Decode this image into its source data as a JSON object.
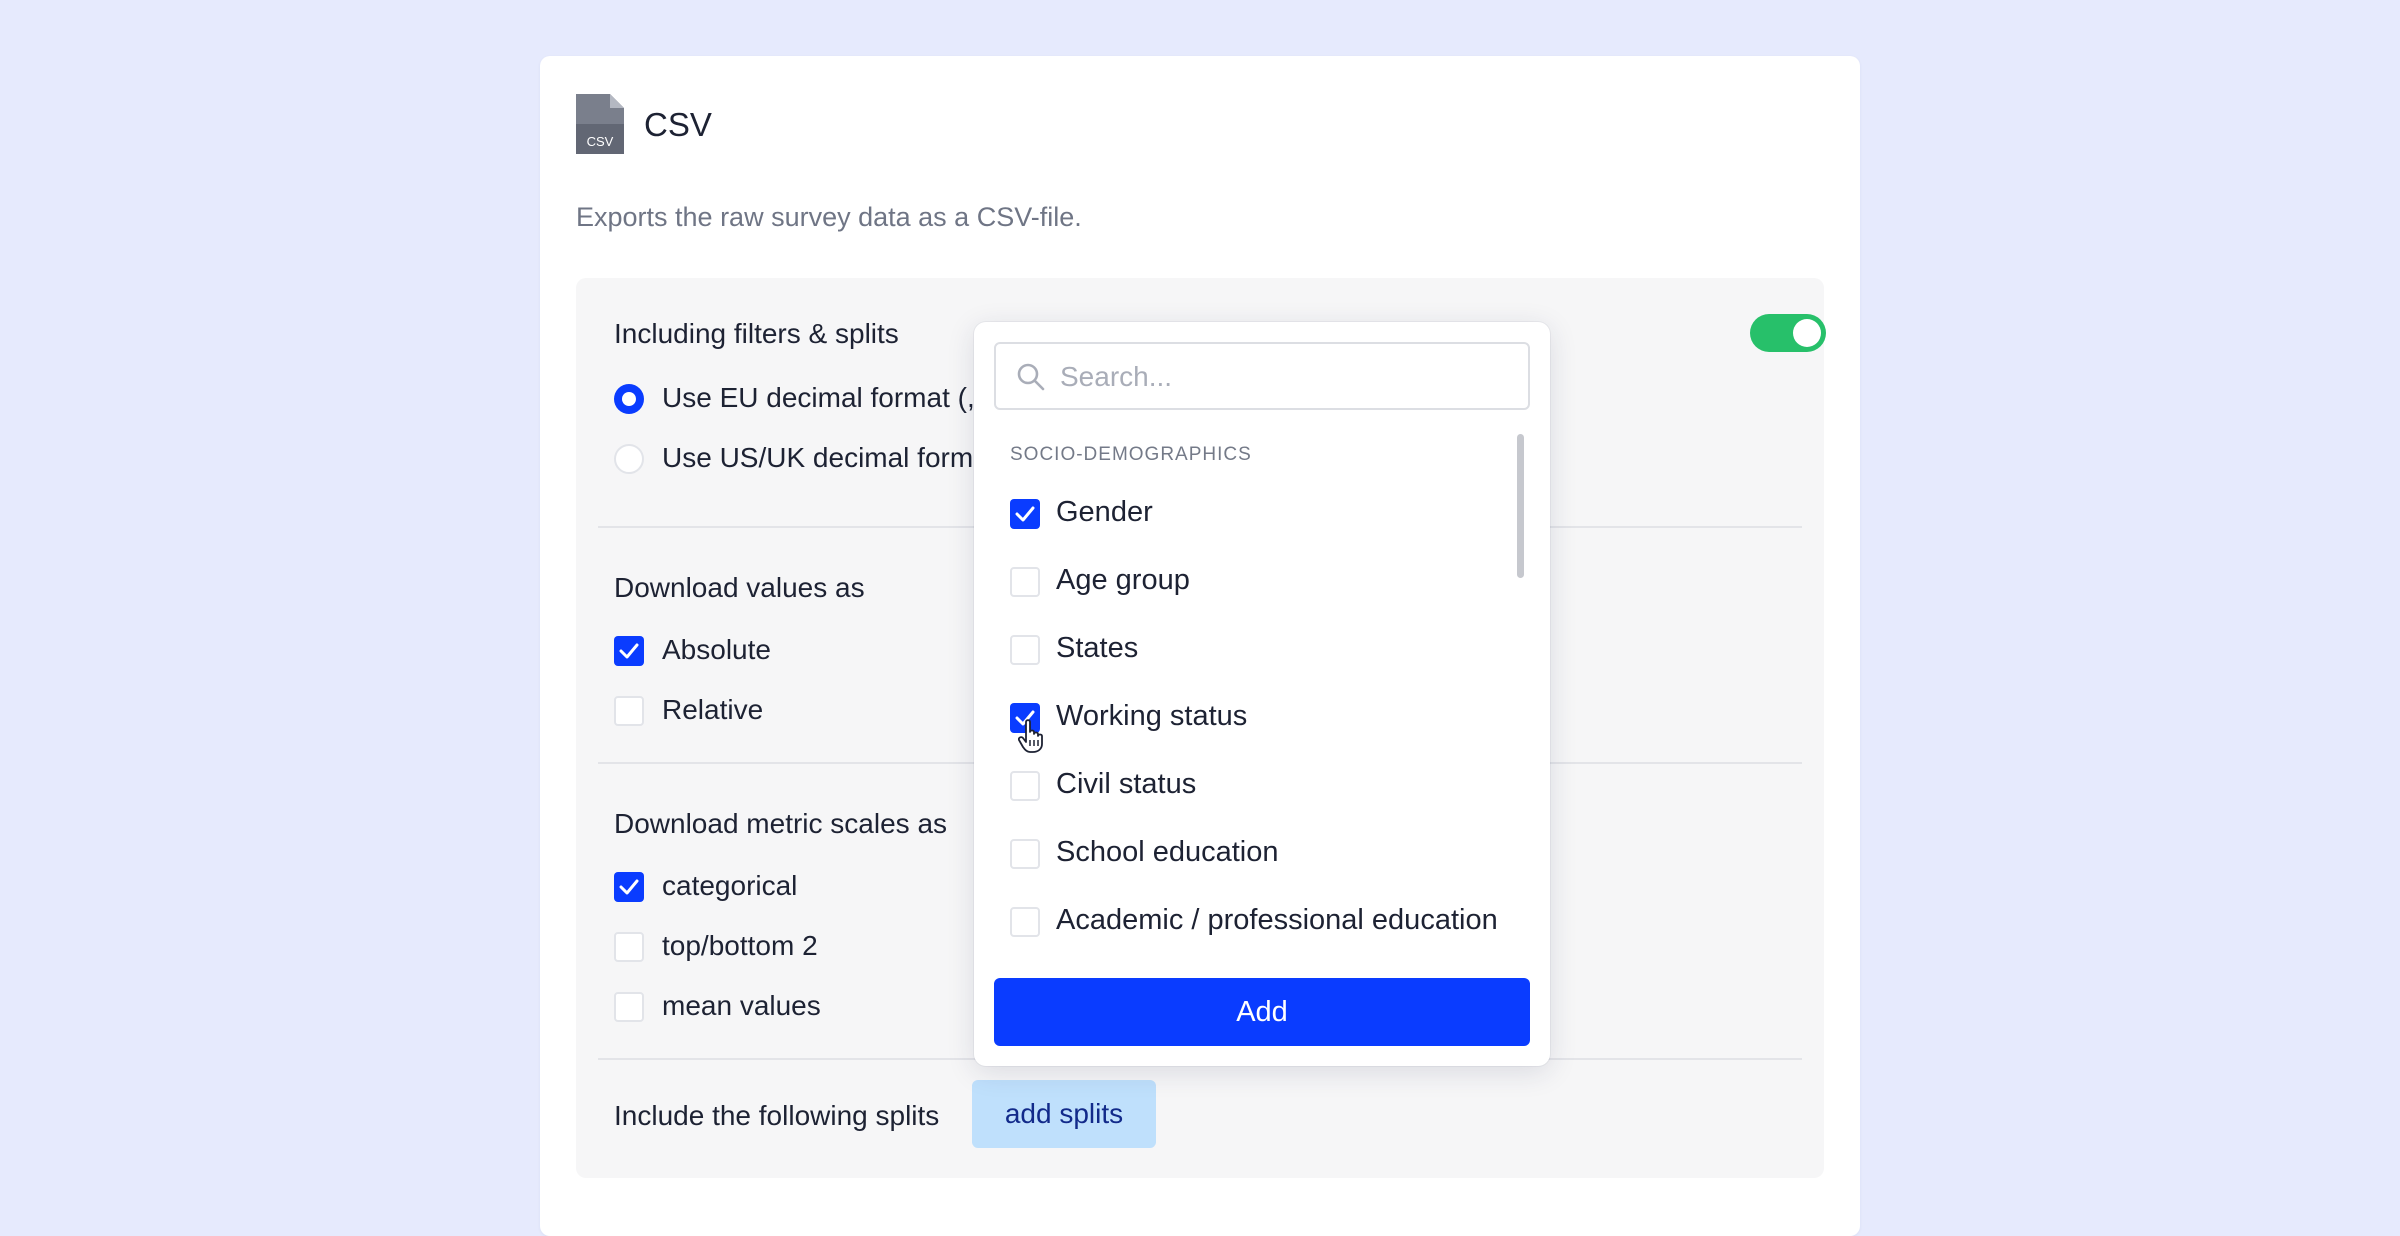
{
  "card": {
    "file_icon_text": "CSV",
    "title": "CSV",
    "description": "Exports the raw survey data as a CSV-file."
  },
  "panel": {
    "filters_label": "Including filters & splits",
    "filters_toggle_on": true,
    "decimal_options": [
      {
        "label": "Use EU decimal format (,",
        "selected": true
      },
      {
        "label": "Use US/UK decimal form",
        "selected": false
      }
    ],
    "values_heading": "Download values as",
    "values_options": [
      {
        "label": "Absolute",
        "checked": true
      },
      {
        "label": "Relative",
        "checked": false
      }
    ],
    "metric_heading": "Download metric scales as",
    "metric_options": [
      {
        "label": "categorical",
        "checked": true
      },
      {
        "label": "top/bottom 2",
        "checked": false
      },
      {
        "label": "mean values",
        "checked": false
      }
    ],
    "splits_label": "Include the following splits",
    "splits_button": "add splits"
  },
  "dropdown": {
    "search_placeholder": "Search...",
    "group_label": "SOCIO-DEMOGRAPHICS",
    "items": [
      {
        "label": "Gender",
        "checked": true
      },
      {
        "label": "Age group",
        "checked": false
      },
      {
        "label": "States",
        "checked": false
      },
      {
        "label": "Working status",
        "checked": true
      },
      {
        "label": "Civil status",
        "checked": false
      },
      {
        "label": "School education",
        "checked": false
      },
      {
        "label": "Academic / professional education",
        "checked": false
      }
    ],
    "add_button": "Add"
  },
  "colors": {
    "background": "#e6eafd",
    "accent": "#0a3cff",
    "toggle_on": "#27c06a",
    "split_button_bg": "#bfe0fc"
  }
}
